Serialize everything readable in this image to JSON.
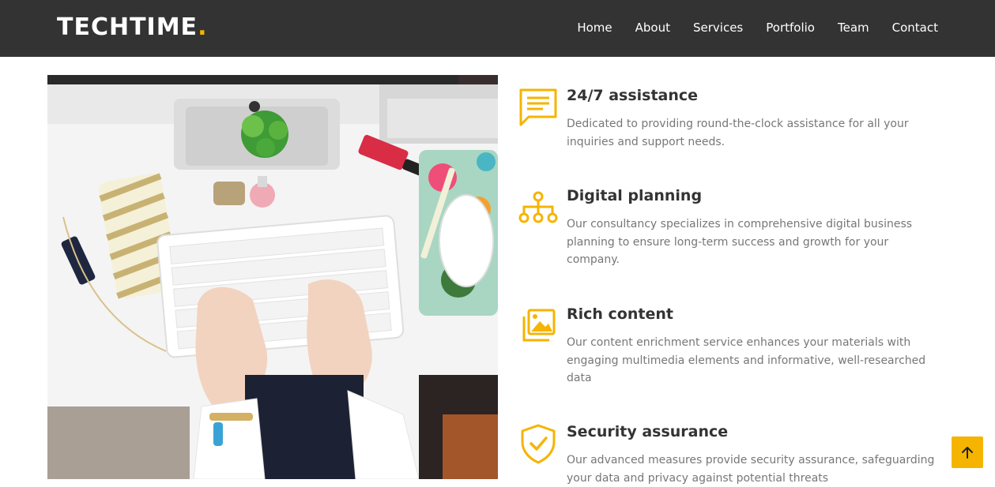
{
  "brand": {
    "name": "TECHTIME",
    "dot": ".",
    "accent_color": "#f5b400"
  },
  "nav": {
    "items": [
      {
        "label": "Home"
      },
      {
        "label": "About"
      },
      {
        "label": "Services"
      },
      {
        "label": "Portfolio"
      },
      {
        "label": "Team"
      },
      {
        "label": "Contact"
      }
    ]
  },
  "hero_image": {
    "icon": "desk-photo"
  },
  "features": [
    {
      "icon": "chat-bubble-icon",
      "title": "24/7 assistance",
      "description": "Dedicated to providing round-the-clock assistance for all your inquiries and support needs."
    },
    {
      "icon": "sitemap-icon",
      "title": "Digital planning",
      "description": "Our consultancy specializes in comprehensive digital business planning to ensure long-term success and growth for your company."
    },
    {
      "icon": "images-icon",
      "title": "Rich content",
      "description": "Our content enrichment service enhances your materials with engaging multimedia elements and informative, well-researched data"
    },
    {
      "icon": "shield-check-icon",
      "title": "Security assurance",
      "description": "Our advanced measures provide security assurance, safeguarding your data and privacy against potential threats"
    }
  ],
  "back_to_top": {
    "icon": "arrow-up-icon"
  }
}
